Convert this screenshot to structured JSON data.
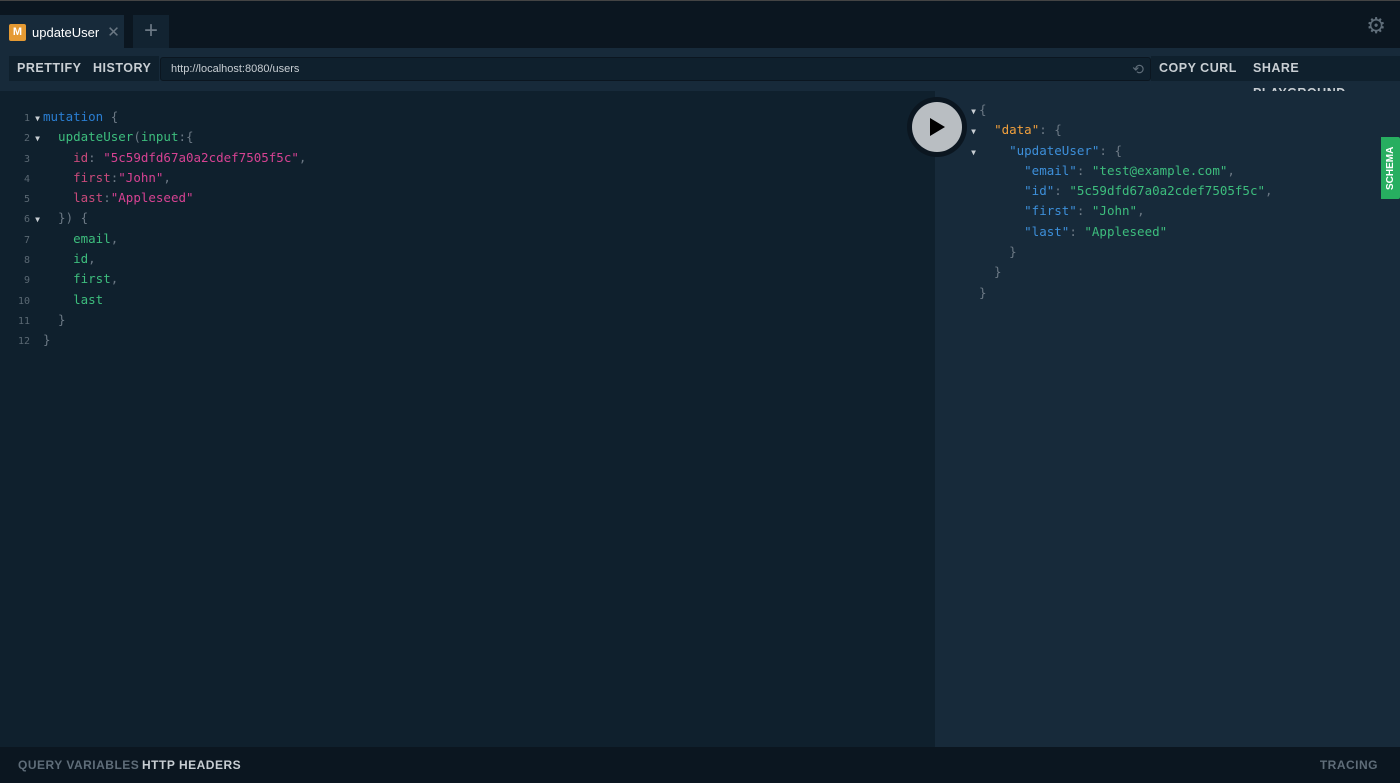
{
  "tabs": [
    {
      "badge": "M",
      "label": "updateUser"
    }
  ],
  "toolbar": {
    "prettify": "PRETTIFY",
    "history": "HISTORY",
    "url": "http://localhost:8080/users",
    "copy_curl": "COPY CURL",
    "share": "SHARE PLAYGROUND"
  },
  "colors": {
    "keyword": "#2a7ed2",
    "field": "#3dbd7d",
    "arg": "#c94a7b",
    "string": "#d64292",
    "punct": "#6b7884",
    "json_key": "#3d8fd9",
    "json_value": "#3dbd7d",
    "json_data_key": "#f1a03d"
  },
  "query_lines": [
    {
      "n": "1",
      "fold": true,
      "t": [
        [
          "mutation",
          "keyword"
        ],
        [
          " {",
          "punct"
        ]
      ]
    },
    {
      "n": "2",
      "fold": true,
      "t": [
        [
          "  updateUser",
          "field"
        ],
        [
          "(",
          "punct"
        ],
        [
          "input",
          "field"
        ],
        [
          ":{",
          "punct"
        ]
      ]
    },
    {
      "n": "3",
      "t": [
        [
          "    id",
          "arg"
        ],
        [
          ": ",
          "punct"
        ],
        [
          "\"5c59dfd67a0a2cdef7505f5c\"",
          "string"
        ],
        [
          ",",
          "punct"
        ]
      ]
    },
    {
      "n": "4",
      "t": [
        [
          "    first",
          "arg"
        ],
        [
          ":",
          "punct"
        ],
        [
          "\"John\"",
          "string"
        ],
        [
          ",",
          "punct"
        ]
      ]
    },
    {
      "n": "5",
      "t": [
        [
          "    last",
          "arg"
        ],
        [
          ":",
          "punct"
        ],
        [
          "\"Appleseed\"",
          "string"
        ]
      ]
    },
    {
      "n": "6",
      "fold": true,
      "t": [
        [
          "  }) {",
          "punct"
        ]
      ]
    },
    {
      "n": "7",
      "t": [
        [
          "    email",
          "field"
        ],
        [
          ",",
          "punct"
        ]
      ]
    },
    {
      "n": "8",
      "t": [
        [
          "    id",
          "field"
        ],
        [
          ",",
          "punct"
        ]
      ]
    },
    {
      "n": "9",
      "t": [
        [
          "    first",
          "field"
        ],
        [
          ",",
          "punct"
        ]
      ]
    },
    {
      "n": "10",
      "t": [
        [
          "    last",
          "field"
        ]
      ]
    },
    {
      "n": "11",
      "t": [
        [
          "  }",
          "punct"
        ]
      ]
    },
    {
      "n": "12",
      "t": [
        [
          "}",
          "punct"
        ]
      ]
    }
  ],
  "result_lines": [
    {
      "fold": true,
      "t": [
        [
          "{",
          "punct"
        ]
      ]
    },
    {
      "fold": true,
      "t": [
        [
          "  ",
          ""
        ],
        [
          "\"data\"",
          "json_data_key"
        ],
        [
          ": {",
          "punct"
        ]
      ]
    },
    {
      "fold": true,
      "t": [
        [
          "    ",
          ""
        ],
        [
          "\"updateUser\"",
          "json_key"
        ],
        [
          ": {",
          "punct"
        ]
      ]
    },
    {
      "t": [
        [
          "      ",
          ""
        ],
        [
          "\"email\"",
          "json_key"
        ],
        [
          ": ",
          "punct"
        ],
        [
          "\"test@example.com\"",
          "json_value"
        ],
        [
          ",",
          "punct"
        ]
      ]
    },
    {
      "t": [
        [
          "      ",
          ""
        ],
        [
          "\"id\"",
          "json_key"
        ],
        [
          ": ",
          "punct"
        ],
        [
          "\"5c59dfd67a0a2cdef7505f5c\"",
          "json_value"
        ],
        [
          ",",
          "punct"
        ]
      ]
    },
    {
      "t": [
        [
          "      ",
          ""
        ],
        [
          "\"first\"",
          "json_key"
        ],
        [
          ": ",
          "punct"
        ],
        [
          "\"John\"",
          "json_value"
        ],
        [
          ",",
          "punct"
        ]
      ]
    },
    {
      "t": [
        [
          "      ",
          ""
        ],
        [
          "\"last\"",
          "json_key"
        ],
        [
          ": ",
          "punct"
        ],
        [
          "\"Appleseed\"",
          "json_value"
        ]
      ]
    },
    {
      "t": [
        [
          "    }",
          "punct"
        ]
      ]
    },
    {
      "t": [
        [
          "  }",
          "punct"
        ]
      ]
    },
    {
      "t": [
        [
          "}",
          "punct"
        ]
      ]
    }
  ],
  "schema_tab": "SCHEMA",
  "bottom": {
    "query_variables": "QUERY VARIABLES",
    "http_headers": "HTTP HEADERS",
    "tracing": "TRACING"
  }
}
